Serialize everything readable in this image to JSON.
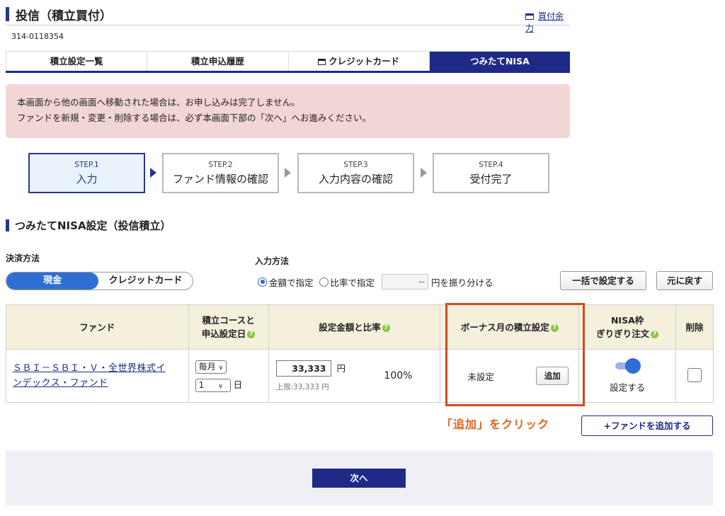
{
  "header": {
    "title": "投信（積立買付）",
    "buying_power_link": "買付余力",
    "account_number": "314-0118354"
  },
  "tabs": [
    {
      "label": "積立設定一覧",
      "active": false,
      "icon": ""
    },
    {
      "label": "積立申込履歴",
      "active": false,
      "icon": ""
    },
    {
      "label": "クレジットカード",
      "active": false,
      "icon": "window-icon"
    },
    {
      "label": "つみたてNISA",
      "active": true,
      "icon": ""
    }
  ],
  "notice": {
    "line1": "本画面から他の画面へ移動された場合は、お申し込みは完了しません。",
    "line2": "ファンドを新規・変更・削除する場合は、必ず本画面下部の「次へ」へお進みください。"
  },
  "steps": [
    {
      "num": "STEP.1",
      "label": "入力",
      "active": true
    },
    {
      "num": "STEP.2",
      "label": "ファンド情報の確認",
      "active": false
    },
    {
      "num": "STEP.3",
      "label": "入力内容の確認",
      "active": false
    },
    {
      "num": "STEP.4",
      "label": "受付完了",
      "active": false
    }
  ],
  "section": {
    "title": "つみたてNISA設定（投信積立）",
    "payment_label": "決済方法",
    "payment_cash": "現金",
    "payment_card": "クレジットカード",
    "input_method_label": "入力方法",
    "radio_amount": "金額で指定",
    "radio_ratio": "比率で指定",
    "ratio_placeholder": "--",
    "distribute_text": "円を振り分ける",
    "bulk_set_button": "一括で設定する",
    "reset_button": "元に戻す"
  },
  "table": {
    "headers": {
      "fund": "ファンド",
      "course_line1": "積立コースと",
      "course_line2": "申込設定日",
      "amount_ratio": "設定金額と比率",
      "bonus": "ボーナス月の積立設定",
      "nisa_line1": "NISA枠",
      "nisa_line2": "ぎりぎり注文",
      "delete": "削除"
    },
    "row": {
      "fund_line1": "ＳＢＩ－ＳＢＩ・Ｖ・全世界株式イ",
      "fund_line2": "ンデックス・ファンド",
      "course": "毎月",
      "day": "1",
      "day_unit": "日",
      "amount": "33,333",
      "yen": "円",
      "limit": "上限:33,333 円",
      "ratio": "100%",
      "bonus_status": "未設定",
      "bonus_add_button": "追加",
      "nisa_status": "設定する"
    }
  },
  "annotation": "「追加」をクリック",
  "add_fund_button": "+ファンドを追加する",
  "next_button": "次へ",
  "colors": {
    "navy": "#1e2a86",
    "blue_accent": "#2f6fd3",
    "notice_bg": "#f2d5d5",
    "table_header_bg": "#f5f0dc",
    "highlight": "#d24a1e",
    "annotation": "#e0631c",
    "help_icon": "#8cc63f"
  }
}
